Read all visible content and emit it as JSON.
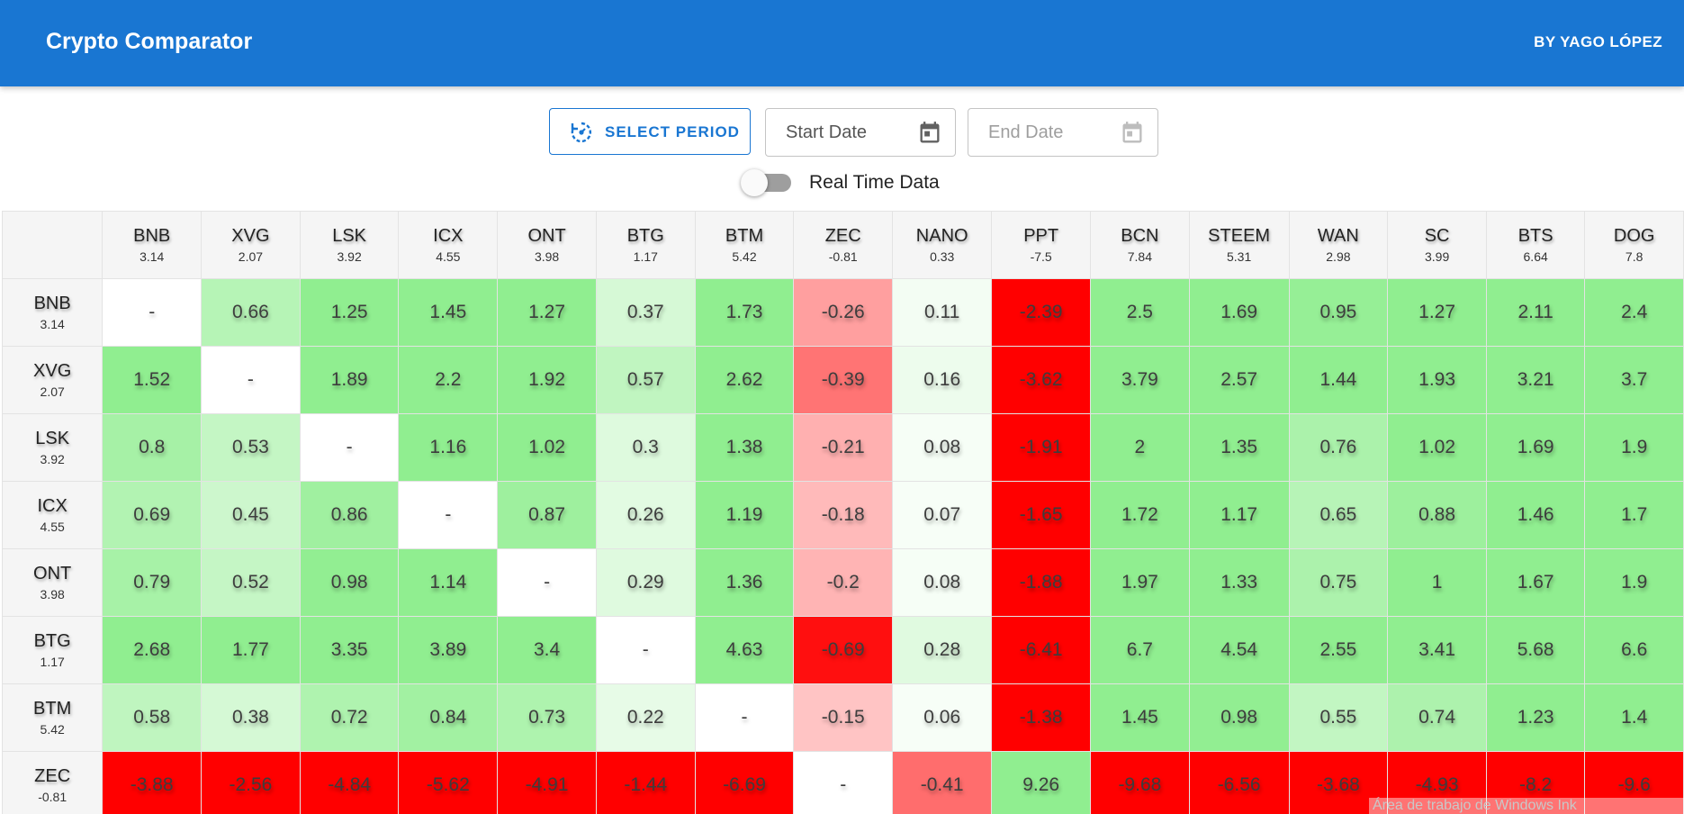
{
  "header": {
    "title": "Crypto Comparator",
    "author": "BY YAGO LÓPEZ"
  },
  "controls": {
    "select_period_label": "SELECT PERIOD",
    "start_date_placeholder": "Start Date",
    "end_date_placeholder": "End Date",
    "realtime_label": "Real Time Data",
    "realtime_enabled": false
  },
  "colors": {
    "primary": "#1976d2",
    "positive_max": "#90ee90",
    "negative_max": "#ff0000",
    "diagonal": "#ffffff"
  },
  "columns": [
    {
      "symbol": "BNB",
      "change": "3.14"
    },
    {
      "symbol": "XVG",
      "change": "2.07"
    },
    {
      "symbol": "LSK",
      "change": "3.92"
    },
    {
      "symbol": "ICX",
      "change": "4.55"
    },
    {
      "symbol": "ONT",
      "change": "3.98"
    },
    {
      "symbol": "BTG",
      "change": "1.17"
    },
    {
      "symbol": "BTM",
      "change": "5.42"
    },
    {
      "symbol": "ZEC",
      "change": "-0.81"
    },
    {
      "symbol": "NANO",
      "change": "0.33"
    },
    {
      "symbol": "PPT",
      "change": "-7.5"
    },
    {
      "symbol": "BCN",
      "change": "7.84"
    },
    {
      "symbol": "STEEM",
      "change": "5.31"
    },
    {
      "symbol": "WAN",
      "change": "2.98"
    },
    {
      "symbol": "SC",
      "change": "3.99"
    },
    {
      "symbol": "BTS",
      "change": "6.64"
    },
    {
      "symbol": "DOG",
      "change": "7.8"
    }
  ],
  "rows": [
    {
      "symbol": "BNB",
      "change": "3.14",
      "cells": [
        "-",
        "0.66",
        "1.25",
        "1.45",
        "1.27",
        "0.37",
        "1.73",
        "-0.26",
        "0.11",
        "-2.39",
        "2.5",
        "1.69",
        "0.95",
        "1.27",
        "2.11",
        "2.4"
      ]
    },
    {
      "symbol": "XVG",
      "change": "2.07",
      "cells": [
        "1.52",
        "-",
        "1.89",
        "2.2",
        "1.92",
        "0.57",
        "2.62",
        "-0.39",
        "0.16",
        "-3.62",
        "3.79",
        "2.57",
        "1.44",
        "1.93",
        "3.21",
        "3.7"
      ]
    },
    {
      "symbol": "LSK",
      "change": "3.92",
      "cells": [
        "0.8",
        "0.53",
        "-",
        "1.16",
        "1.02",
        "0.3",
        "1.38",
        "-0.21",
        "0.08",
        "-1.91",
        "2",
        "1.35",
        "0.76",
        "1.02",
        "1.69",
        "1.9"
      ]
    },
    {
      "symbol": "ICX",
      "change": "4.55",
      "cells": [
        "0.69",
        "0.45",
        "0.86",
        "-",
        "0.87",
        "0.26",
        "1.19",
        "-0.18",
        "0.07",
        "-1.65",
        "1.72",
        "1.17",
        "0.65",
        "0.88",
        "1.46",
        "1.7"
      ]
    },
    {
      "symbol": "ONT",
      "change": "3.98",
      "cells": [
        "0.79",
        "0.52",
        "0.98",
        "1.14",
        "-",
        "0.29",
        "1.36",
        "-0.2",
        "0.08",
        "-1.88",
        "1.97",
        "1.33",
        "0.75",
        "1",
        "1.67",
        "1.9"
      ]
    },
    {
      "symbol": "BTG",
      "change": "1.17",
      "cells": [
        "2.68",
        "1.77",
        "3.35",
        "3.89",
        "3.4",
        "-",
        "4.63",
        "-0.69",
        "0.28",
        "-6.41",
        "6.7",
        "4.54",
        "2.55",
        "3.41",
        "5.68",
        "6.6"
      ]
    },
    {
      "symbol": "BTM",
      "change": "5.42",
      "cells": [
        "0.58",
        "0.38",
        "0.72",
        "0.84",
        "0.73",
        "0.22",
        "-",
        "-0.15",
        "0.06",
        "-1.38",
        "1.45",
        "0.98",
        "0.55",
        "0.74",
        "1.23",
        "1.4"
      ]
    },
    {
      "symbol": "ZEC",
      "change": "-0.81",
      "cells": [
        "-3.88",
        "-2.56",
        "-4.84",
        "-5.62",
        "-4.91",
        "-1.44",
        "-6.69",
        "-",
        "-0.41",
        "9.26",
        "-9.68",
        "-6.56",
        "-3.68",
        "-4.93",
        "-8.2",
        "-9.6"
      ]
    }
  ],
  "os_overlay": {
    "text": "Área de trabajo de Windows Ink"
  }
}
